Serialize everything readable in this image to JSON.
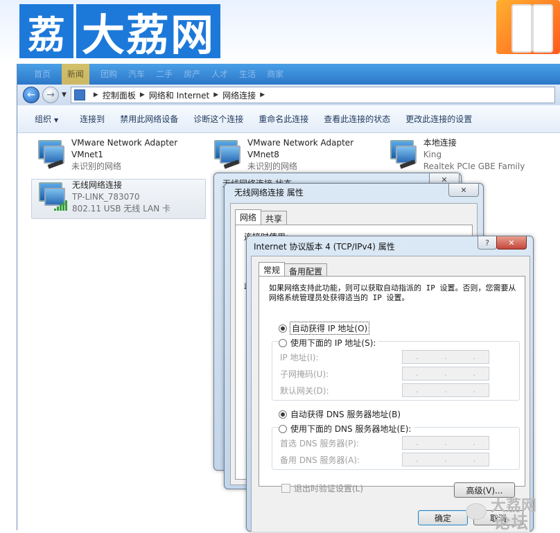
{
  "banner": {
    "logo_char": "荔",
    "logo_text": "大荔网"
  },
  "nav_tabs": [
    "首页",
    "新闻",
    "团购",
    "汽车",
    "二手",
    "房产",
    "人才",
    "生活",
    "商家"
  ],
  "breadcrumb": [
    "控制面板",
    "网络和 Internet",
    "网络连接"
  ],
  "toolbar": {
    "organize": "组织",
    "connect_to": "连接到",
    "disable": "禁用此网络设备",
    "diagnose": "诊断这个连接",
    "rename": "重命名此连接",
    "view_status": "查看此连接的状态",
    "change_settings": "更改此连接的设置"
  },
  "adapters": [
    {
      "name": "VMware Network Adapter",
      "name2": "VMnet1",
      "status": "未识别的网络"
    },
    {
      "name": "VMware Network Adapter",
      "name2": "VMnet8",
      "status": "未识别的网络"
    },
    {
      "name": "本地连接",
      "name2": "King",
      "status": "Realtek PCIe GBE Family Contr..."
    },
    {
      "name": "无线网络连接",
      "name2": "TP-LINK_783070",
      "status": "802.11 USB 无线 LAN 卡"
    }
  ],
  "status_dialog": {
    "title": "无线网络连接 状态"
  },
  "props_dialog": {
    "title": "无线网络连接 属性",
    "tab_network": "网络",
    "tab_share": "共享",
    "connect_using": "连接时使用:",
    "this_conn": "此"
  },
  "tcp_dialog": {
    "title": "Internet 协议版本 4 (TCP/IPv4) 属性",
    "help": "?",
    "close": "✕",
    "tab_general": "常规",
    "tab_alternate": "备用配置",
    "description": "如果网络支持此功能，则可以获取自动指派的 IP 设置。否则，您需要从网络系统管理员处获得适当的 IP 设置。",
    "auto_ip": "自动获得 IP 地址(O)",
    "manual_ip": "使用下面的 IP 地址(S):",
    "ip_label": "IP 地址(I):",
    "mask_label": "子网掩码(U):",
    "gateway_label": "默认网关(D):",
    "auto_dns": "自动获得 DNS 服务器地址(B)",
    "manual_dns": "使用下面的 DNS 服务器地址(E):",
    "dns1_label": "首选 DNS 服务器(P):",
    "dns2_label": "备用 DNS 服务器(A):",
    "validate": "退出时验证设置(L)",
    "advanced": "高级(V)...",
    "ok": "确定",
    "cancel": "取消"
  },
  "watermark": {
    "line1": "大荔网",
    "line2": "论坛"
  }
}
